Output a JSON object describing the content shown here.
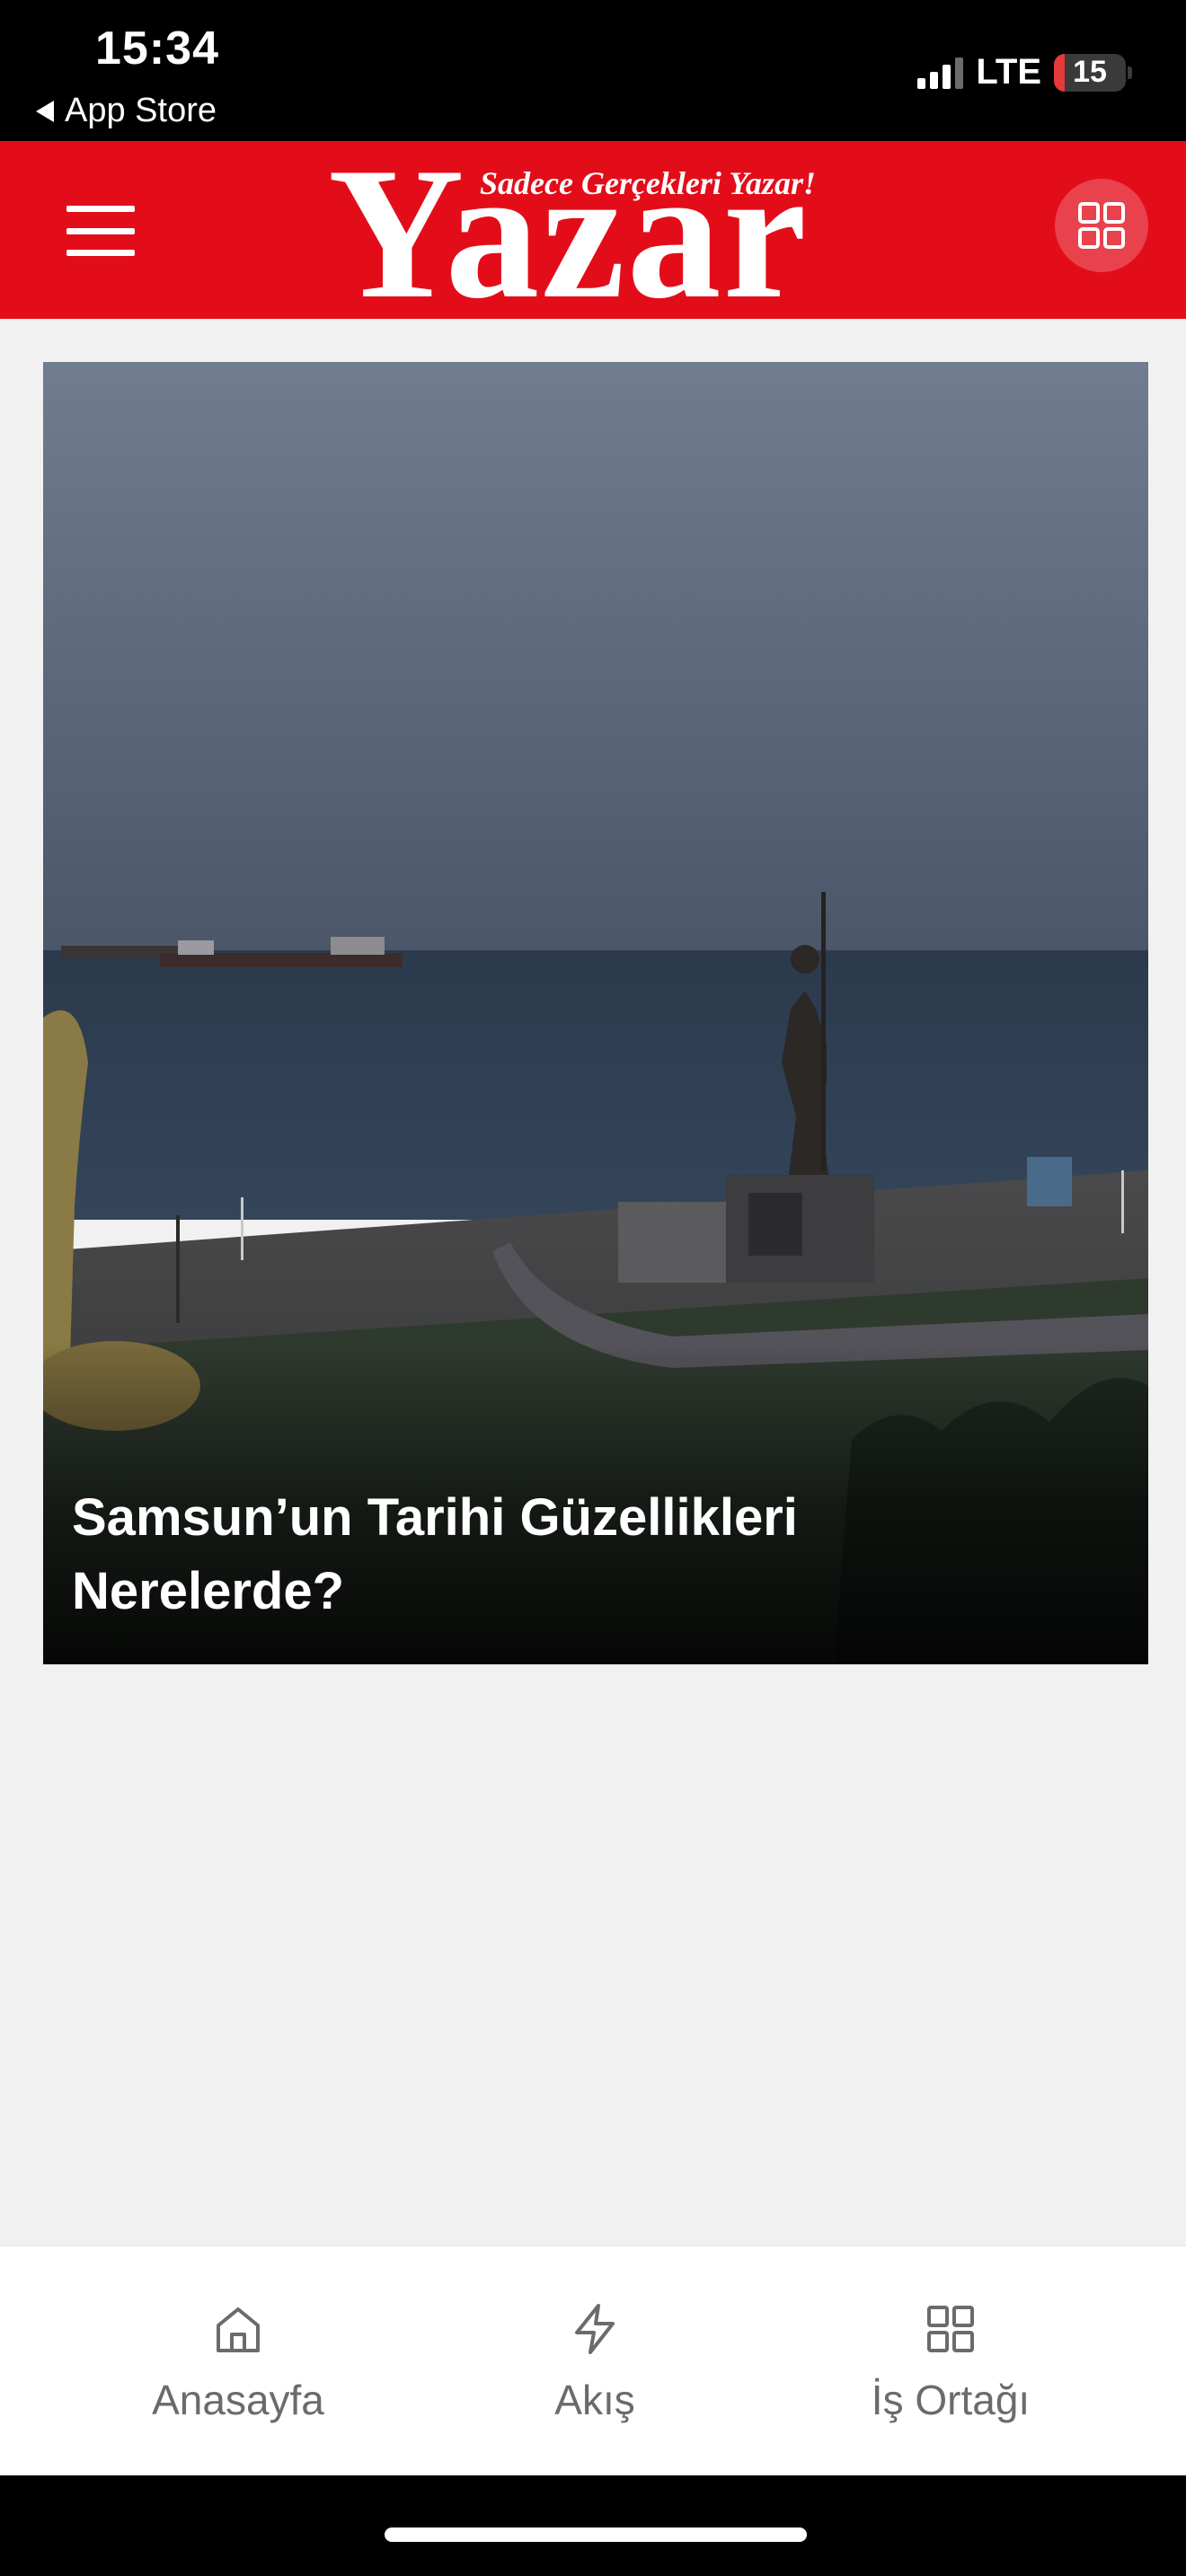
{
  "status_bar": {
    "time": "15:34",
    "back_label": "App Store",
    "network": "LTE",
    "battery": "15",
    "battery_level": 0.15
  },
  "header": {
    "logo_text": "Yazar",
    "tagline": "Sadece Gerçekleri Yazar!",
    "menu_icon": "hamburger-menu-icon",
    "apps_icon": "grid-icon",
    "background_color": "#e30d1a"
  },
  "main": {
    "featured": {
      "title": "Samsun’un Tarihi Güzellikleri Nerelerde?"
    }
  },
  "bottom_nav": {
    "items": [
      {
        "label": "Anasayfa",
        "icon": "home-icon"
      },
      {
        "label": "Akış",
        "icon": "lightning-icon"
      },
      {
        "label": "İş Ortağı",
        "icon": "grid-icon"
      }
    ]
  }
}
